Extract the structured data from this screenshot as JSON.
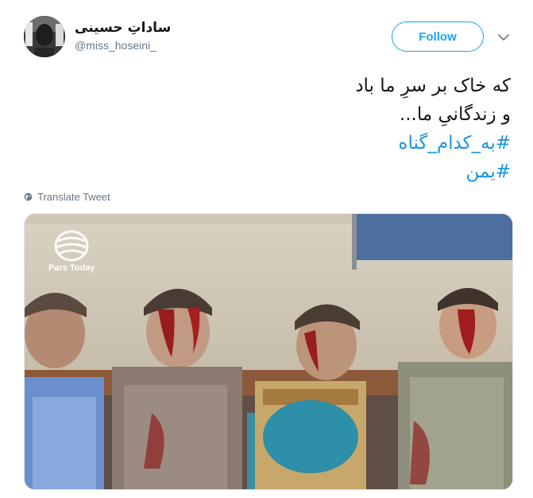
{
  "user": {
    "display_name": "ساداتِ حسینی",
    "handle": "@miss_hoseini_",
    "avatar_icon": "profile-photo"
  },
  "actions": {
    "follow_label": "Follow",
    "more_icon": "chevron-down-icon"
  },
  "tweet": {
    "lines": [
      "که خاک بر سرِ ما باد",
      "و زندگانیِ ما..."
    ],
    "hashtags": [
      "#به_کدام_گناه",
      "#یمن"
    ]
  },
  "translate": {
    "label": "Translate Tweet",
    "icon": "globe-icon"
  },
  "media": {
    "watermark": "Pars Today"
  },
  "colors": {
    "accent": "#1da1f2",
    "hashtag": "#1b95e0",
    "text": "#14171a",
    "secondary": "#657786"
  }
}
